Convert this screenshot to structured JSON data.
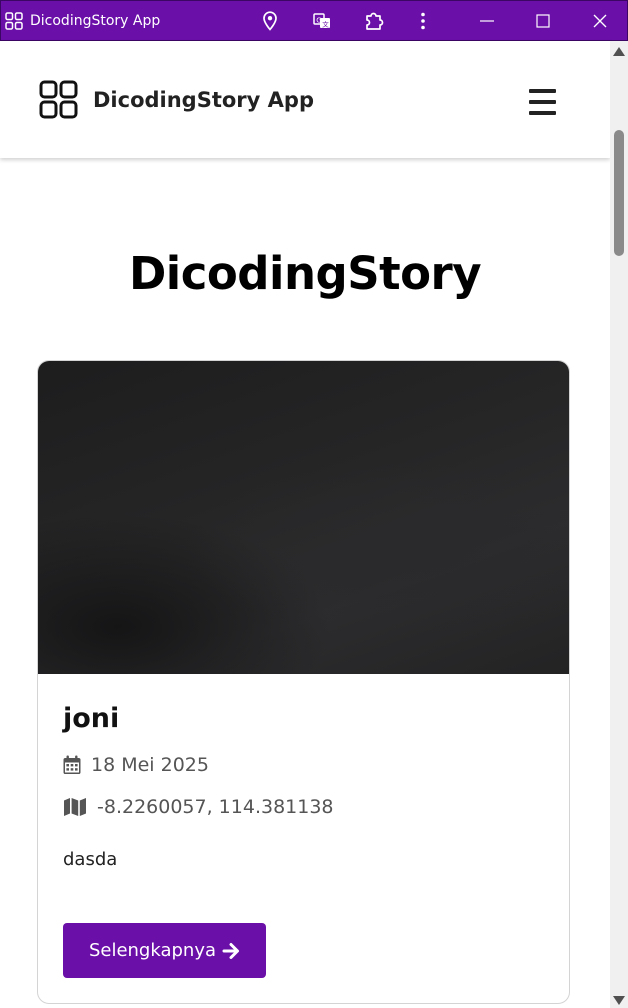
{
  "window": {
    "title": "DicodingStory App",
    "icons": [
      "app-grid-icon",
      "location-pin-icon",
      "translate-icon",
      "extensions-icon",
      "more-vert-icon",
      "minimize-icon",
      "maximize-icon",
      "close-icon"
    ]
  },
  "header": {
    "brand_name": "DicodingStory App",
    "brand_icon": "grid-icon",
    "menu_icon": "hamburger-menu-icon"
  },
  "page": {
    "title": "DicodingStory"
  },
  "story": {
    "author": "joni",
    "date": "18 Mei 2025",
    "location": "-8.2260057, 114.381138",
    "description": "dasda",
    "button_label": "Selengkapnya",
    "date_icon": "calendar-icon",
    "location_icon": "map-icon",
    "button_icon": "arrow-right-icon"
  },
  "colors": {
    "accent": "#6a0fa8",
    "text": "#111111",
    "muted": "#555555"
  }
}
